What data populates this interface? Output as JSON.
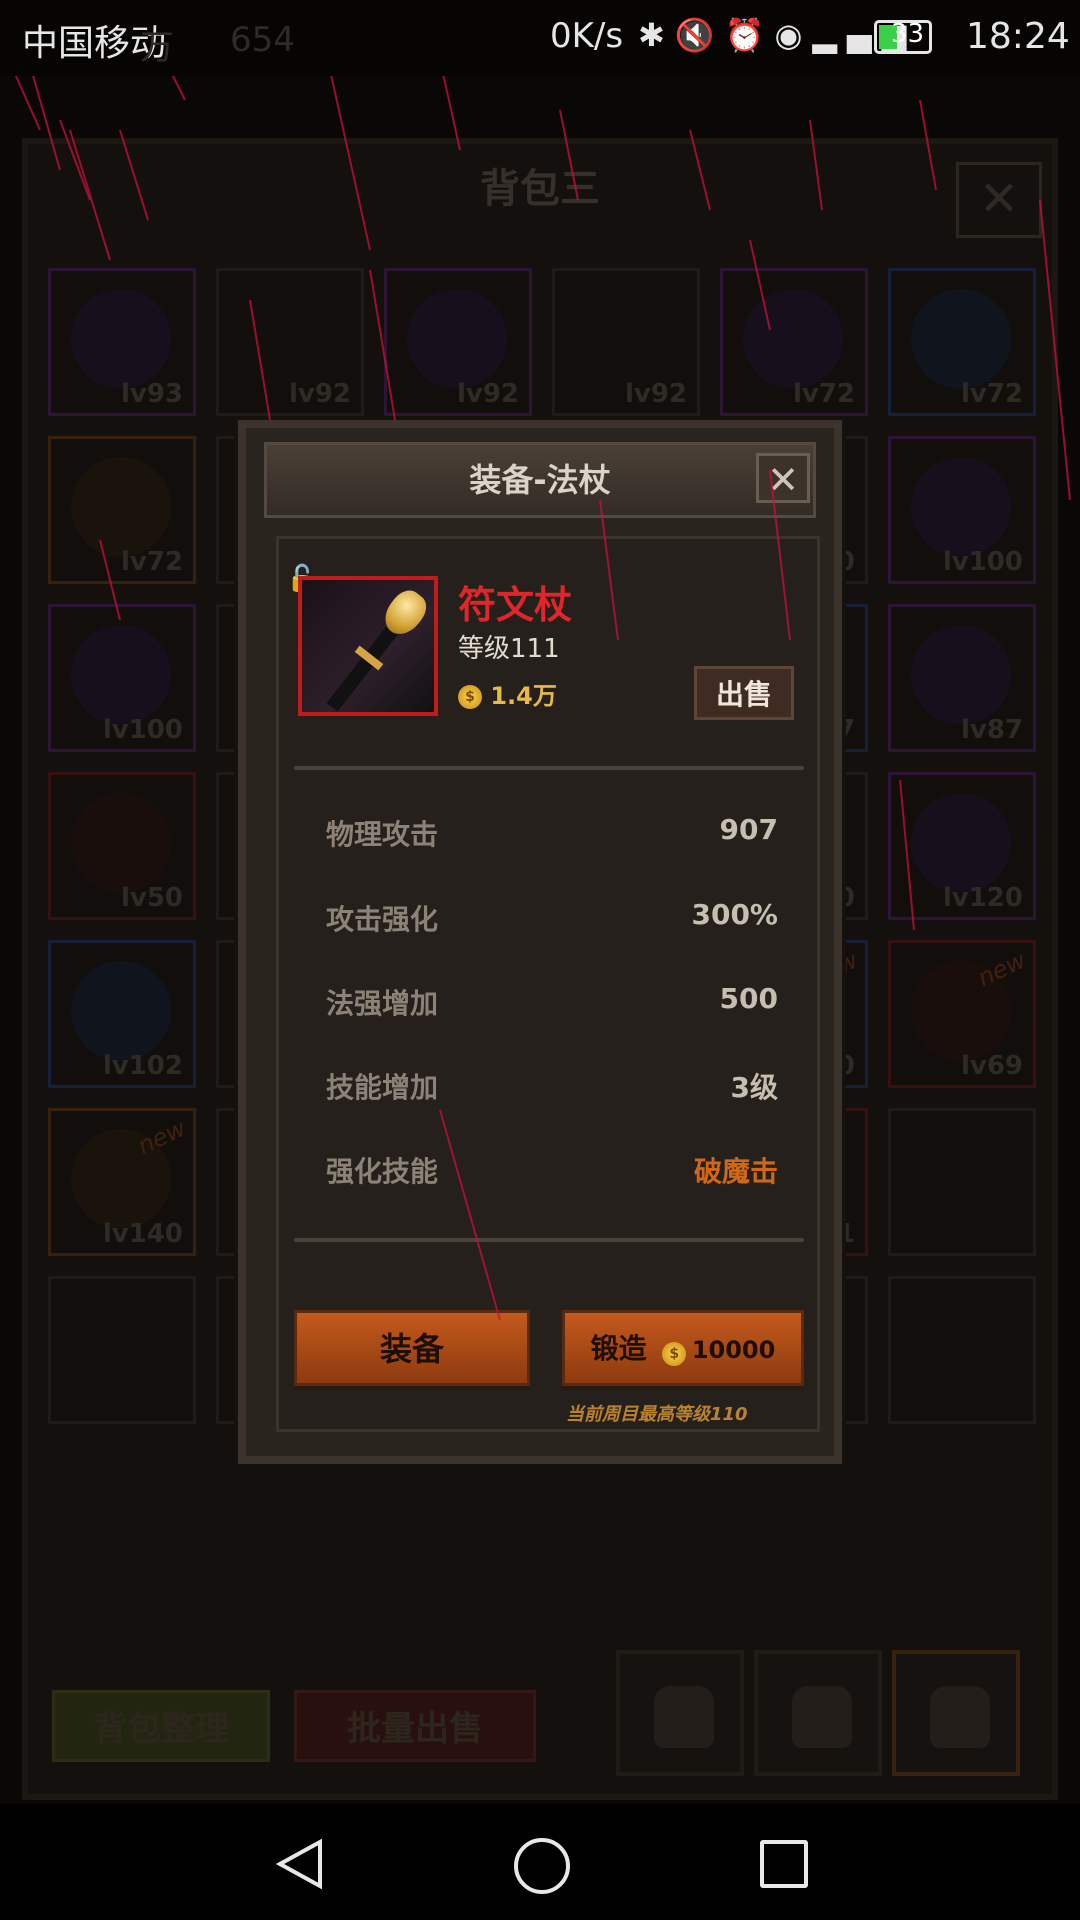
{
  "status_bar": {
    "carrier": "中国移动",
    "network_speed": "0K/s",
    "battery": "33",
    "time": "18:24",
    "icons": [
      "bluetooth-icon",
      "mute-icon",
      "alarm-icon",
      "eye-icon",
      "signal-icon"
    ]
  },
  "background_hud": {
    "hidden_text_1": "万",
    "hidden_number": "654"
  },
  "bag": {
    "title": "背包三",
    "close_label": "✕",
    "sort_label": "背包整理",
    "batch_sell_label": "批量出售",
    "slots": [
      {
        "level": "lv93",
        "rarity": "purple"
      },
      {
        "level": "lv92",
        "rarity": "dark"
      },
      {
        "level": "lv92",
        "rarity": "purple"
      },
      {
        "level": "lv92",
        "rarity": "dark"
      },
      {
        "level": "lv72",
        "rarity": "purple"
      },
      {
        "level": "lv72",
        "rarity": "blue"
      },
      {
        "level": "lv72",
        "rarity": "orange"
      },
      {
        "level": "",
        "rarity": "dark"
      },
      {
        "level": "",
        "rarity": "dark"
      },
      {
        "level": "",
        "rarity": "dark"
      },
      {
        "level": "00",
        "rarity": "dark"
      },
      {
        "level": "lv100",
        "rarity": "purple"
      },
      {
        "level": "lv100",
        "rarity": "purple"
      },
      {
        "level": "",
        "rarity": "dark"
      },
      {
        "level": "",
        "rarity": "dark"
      },
      {
        "level": "",
        "rarity": "dark"
      },
      {
        "level": "7",
        "rarity": "blue"
      },
      {
        "level": "lv87",
        "rarity": "purple"
      },
      {
        "level": "lv50",
        "rarity": "red"
      },
      {
        "level": "",
        "rarity": "dark"
      },
      {
        "level": "",
        "rarity": "dark"
      },
      {
        "level": "",
        "rarity": "dark"
      },
      {
        "level": "0",
        "rarity": "dark"
      },
      {
        "level": "lv120",
        "rarity": "purple"
      },
      {
        "level": "lv102",
        "rarity": "blue"
      },
      {
        "level": "",
        "rarity": "dark"
      },
      {
        "level": "",
        "rarity": "dark"
      },
      {
        "level": "",
        "rarity": "dark"
      },
      {
        "level": "0",
        "rarity": "blue",
        "new": "new"
      },
      {
        "level": "lv69",
        "rarity": "red",
        "new": "new"
      },
      {
        "level": "lv140",
        "rarity": "orange",
        "new": "new"
      },
      {
        "level": "",
        "rarity": "dark"
      },
      {
        "level": "",
        "rarity": "dark"
      },
      {
        "level": "",
        "rarity": "dark"
      },
      {
        "level": "1",
        "rarity": "red"
      },
      {
        "level": "",
        "rarity": "dark"
      }
    ]
  },
  "dialog": {
    "title": "装备-法杖",
    "close_label": "✕",
    "item": {
      "name": "符文杖",
      "level_text": "等级111",
      "price": "1.4万",
      "sell_label": "出售"
    },
    "stats": [
      {
        "label": "物理攻击",
        "value": "907"
      },
      {
        "label": "攻击强化",
        "value": "300%"
      },
      {
        "label": "法强增加",
        "value": "500"
      },
      {
        "label": "技能增加",
        "value": "3级"
      },
      {
        "label": "强化技能",
        "value": "破魔击",
        "highlight": true
      }
    ],
    "equip_label": "装备",
    "forge_label": "锻造",
    "forge_cost": "10000",
    "note": "当前周目最高等级110",
    "colors": {
      "item_name": "#e0262a",
      "accent_orange": "#d16717",
      "button": "#c45a1c",
      "coin": "#ffd44d"
    }
  }
}
